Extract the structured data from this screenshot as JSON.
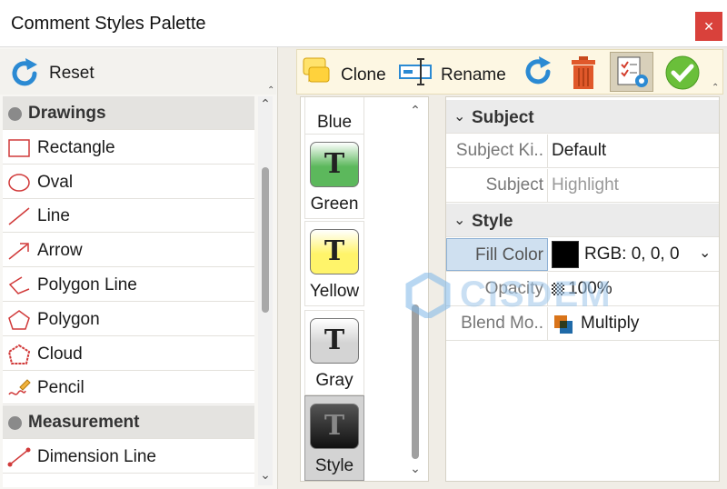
{
  "window": {
    "title": "Comment Styles Palette",
    "close_glyph": "×"
  },
  "left_panel": {
    "reset_label": "Reset",
    "items": [
      {
        "label": "Drawings",
        "group": true,
        "icon": "group-dot-icon"
      },
      {
        "label": "Rectangle",
        "icon": "rectangle-icon"
      },
      {
        "label": "Oval",
        "icon": "oval-icon"
      },
      {
        "label": "Line",
        "icon": "line-icon"
      },
      {
        "label": "Arrow",
        "icon": "arrow-icon"
      },
      {
        "label": "Polygon Line",
        "icon": "polygon-line-icon"
      },
      {
        "label": "Polygon",
        "icon": "polygon-icon"
      },
      {
        "label": "Cloud",
        "icon": "cloud-icon"
      },
      {
        "label": "Pencil",
        "icon": "pencil-icon"
      },
      {
        "label": "Measurement",
        "group": true,
        "icon": "group-dot-icon"
      },
      {
        "label": "Dimension Line",
        "icon": "dimension-line-icon"
      }
    ]
  },
  "toolbar": {
    "clone_label": "Clone",
    "rename_label": "Rename",
    "colors": {
      "accent": "#2b8ad3",
      "trash": "#e0582a",
      "ok": "#6abf3a",
      "frame": "#fdf7e3"
    }
  },
  "styles": {
    "items": [
      {
        "label": "Blue"
      },
      {
        "label": "Green",
        "color": "#5cb85c",
        "glyph": "T"
      },
      {
        "label": "Yellow",
        "color": "#fff46a",
        "glyph": "T"
      },
      {
        "label": "Gray",
        "color": "#d4d4d4",
        "glyph": "T"
      },
      {
        "label": "Style",
        "color": "#222222",
        "glyph": "T",
        "selected": true
      }
    ]
  },
  "properties": {
    "subject_header": "Subject",
    "subject_kind_name": "Subject Ki..",
    "subject_kind_value": "Default",
    "subject_name": "Subject",
    "subject_value": "Highlight",
    "style_header": "Style",
    "fill_color_name": "Fill Color",
    "fill_color_value": "RGB: 0, 0, 0",
    "fill_color_swatch": "#000000",
    "opacity_name": "Opacity",
    "opacity_value": "100%",
    "blend_name": "Blend Mo..",
    "blend_value": "Multiply"
  },
  "watermark": {
    "text": "CISDEM"
  }
}
